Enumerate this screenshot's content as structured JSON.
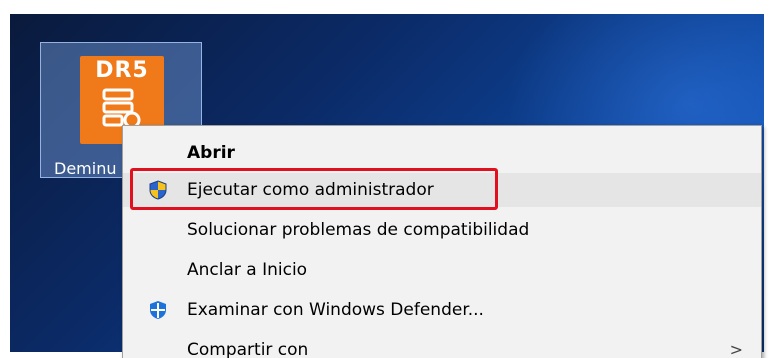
{
  "desktop": {
    "icon": {
      "logo_text": "DR5",
      "label": "Deminu"
    }
  },
  "context_menu": {
    "items": [
      {
        "label": "Abrir",
        "icon": "",
        "bold": true
      },
      {
        "label": "Ejecutar como administrador",
        "icon": "uac-shield-icon",
        "highlighted": true
      },
      {
        "label": "Solucionar problemas de compatibilidad",
        "icon": ""
      },
      {
        "label": "Anclar a Inicio",
        "icon": ""
      },
      {
        "label": "Examinar con Windows Defender...",
        "icon": "windows-defender-icon"
      },
      {
        "label": "Compartir con",
        "icon": "",
        "submenu": true
      }
    ],
    "submenu_arrow": ">"
  },
  "colors": {
    "highlight_border": "#e0101e",
    "app_logo": "#f07a1a",
    "menu_bg": "#f2f2f2",
    "menu_hover": "#e5e5e5"
  }
}
